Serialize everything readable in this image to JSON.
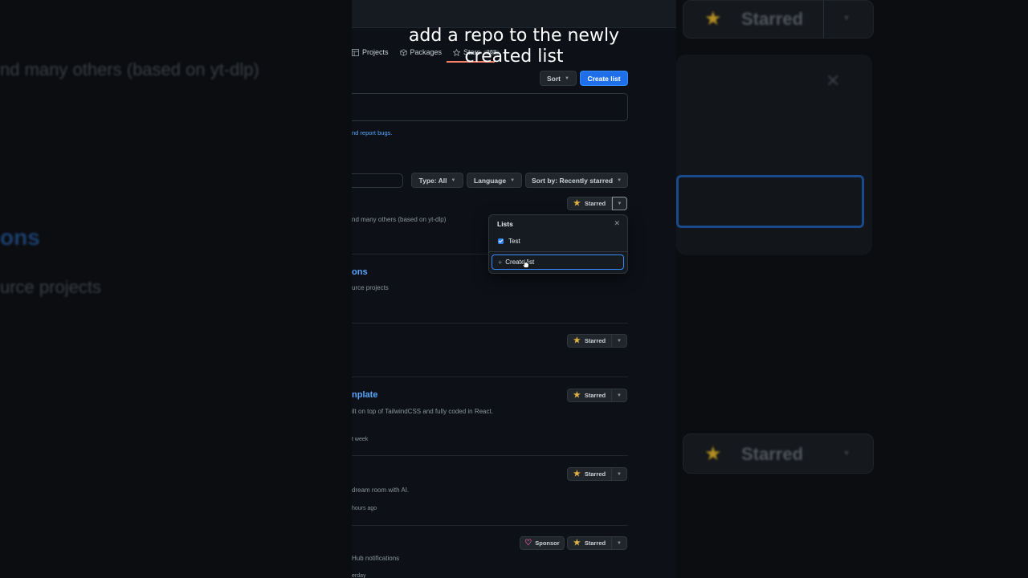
{
  "caption": {
    "line1": "add a repo to the newly",
    "line2": "created list"
  },
  "nav": {
    "projects": "Projects",
    "packages": "Packages",
    "stars": "Stars",
    "stars_count": "163"
  },
  "header_buttons": {
    "sort": "Sort",
    "create_list": "Create list"
  },
  "info_link": "nd report bugs.",
  "filters": {
    "type": "Type: All",
    "language": "Language",
    "sort_by": "Sort by: Recently starred"
  },
  "repos": [
    {
      "description": "nd many others (based on yt-dlp)"
    },
    {
      "name": "ons",
      "description": "urce projects"
    },
    {
      "name": "nplate",
      "description": "ilt on top of TailwindCSS and fully coded in React.",
      "meta": "t week"
    },
    {
      "description": "dream room with AI.",
      "meta": "hours ago"
    },
    {
      "description": "Hub notifications",
      "meta": "erday"
    }
  ],
  "starred_label": "Starred",
  "sponsor_label": "Sponsor",
  "lists_popup": {
    "title": "Lists",
    "close_icon": "close-icon",
    "items": [
      {
        "label": "Test",
        "checked": true
      }
    ],
    "create_label": "Create list"
  },
  "background": {
    "left_line1": "nd many others (based on yt-dlp)",
    "left_line2": "ons",
    "left_line3": "urce projects",
    "right_starred": "Starred"
  },
  "colors": {
    "accent": "#1f6feb",
    "link": "#58a6ff",
    "star": "#e3b341",
    "background": "#0d1117"
  }
}
